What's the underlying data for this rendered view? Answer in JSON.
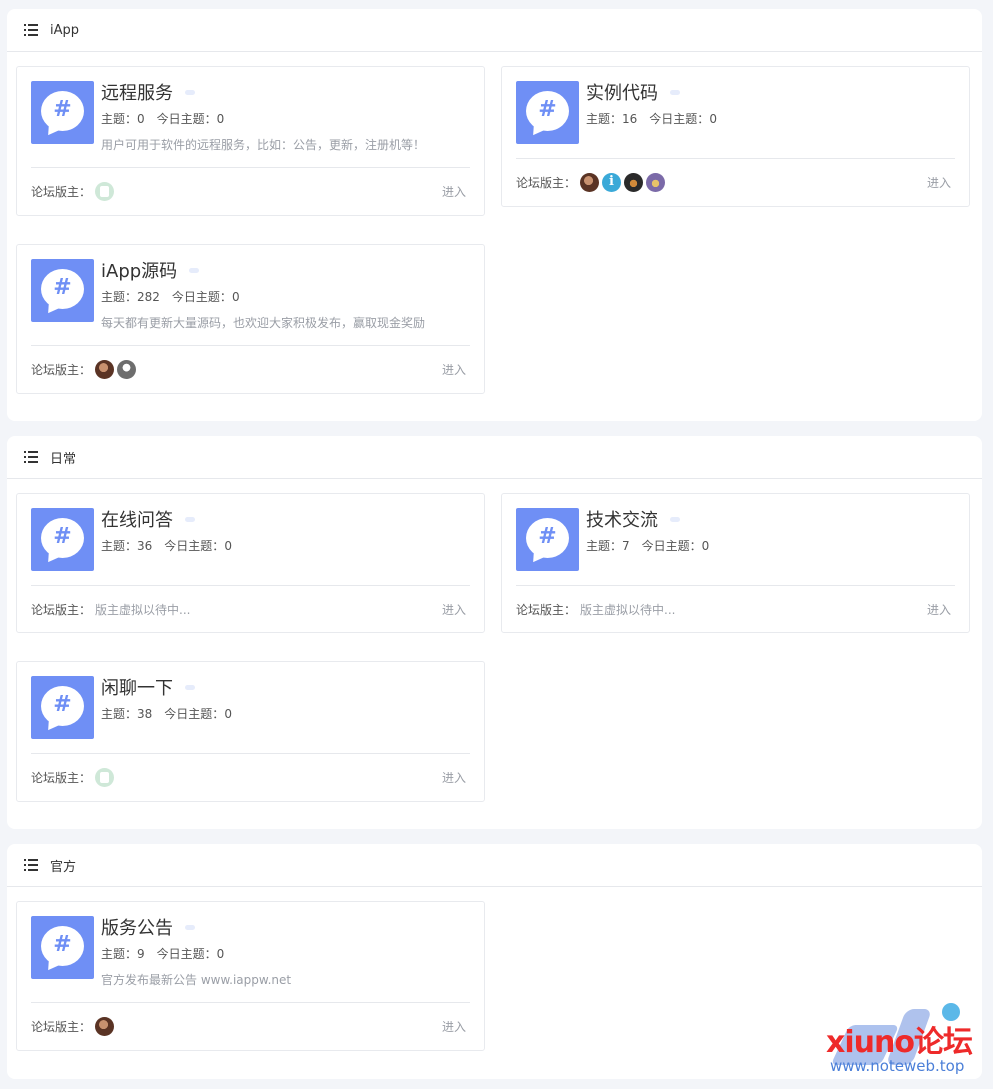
{
  "common": {
    "moderator_label": "论坛版主：",
    "enter_label": "进入",
    "topics_label": "主题：",
    "today_label": "今日主题：",
    "icon_glyph": "#"
  },
  "sections": [
    {
      "title": "iApp",
      "forums": [
        {
          "name": "远程服务",
          "topics": "0",
          "today": "0",
          "description": "用户可用于软件的远程服务，比如：公告，更新，注册机等！",
          "moderators": [
            "avatar-green"
          ]
        },
        {
          "name": "实例代码",
          "topics": "16",
          "today": "0",
          "description": "",
          "moderators": [
            "avatar-brown",
            "avatar-info",
            "avatar-dark",
            "avatar-purple"
          ]
        },
        {
          "name": "iApp源码",
          "topics": "282",
          "today": "0",
          "description": "每天都有更新大量源码，也欢迎大家积极发布，赢取现金奖励",
          "moderators": [
            "avatar-brown",
            "avatar-gray"
          ]
        }
      ]
    },
    {
      "title": "日常",
      "forums": [
        {
          "name": "在线问答",
          "topics": "36",
          "today": "0",
          "description": "",
          "moderators_text": "版主虚拟以待中..."
        },
        {
          "name": "技术交流",
          "topics": "7",
          "today": "0",
          "description": "",
          "moderators_text": "版主虚拟以待中..."
        },
        {
          "name": "闲聊一下",
          "topics": "38",
          "today": "0",
          "description": "",
          "moderators": [
            "avatar-green"
          ]
        }
      ]
    },
    {
      "title": "官方",
      "forums": [
        {
          "name": "版务公告",
          "topics": "9",
          "today": "0",
          "description": "官方发布最新公告 www.iappw.net",
          "moderators": [
            "avatar-brown"
          ]
        }
      ]
    }
  ],
  "watermark": {
    "brand": "xiuno论坛",
    "url": "www.noteweb.top"
  },
  "colors": {
    "accent": "#6f8ff5",
    "background": "#f3f5f9",
    "card_border": "#e8eaee",
    "muted_text": "#9a9ea6"
  }
}
